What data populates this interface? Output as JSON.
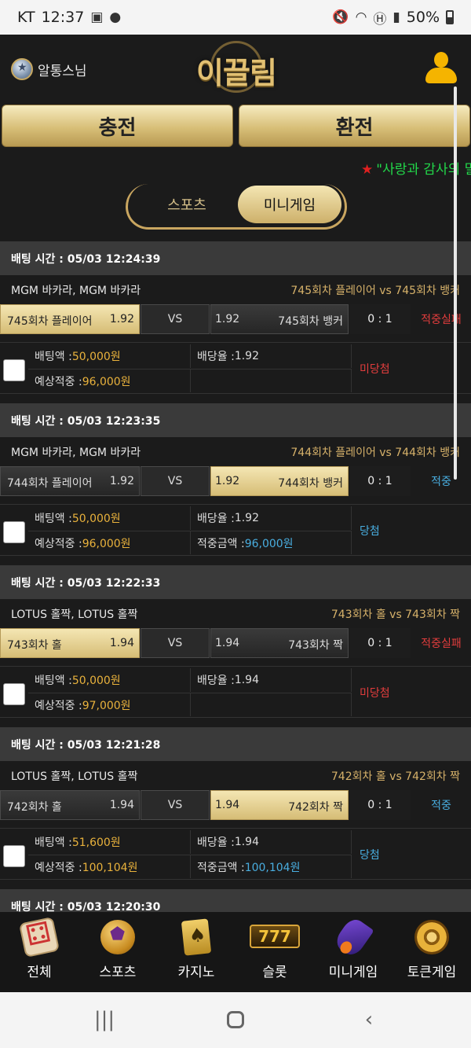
{
  "status_bar": {
    "carrier": "KT",
    "time": "12:37",
    "battery": "50%",
    "icons": [
      "gallery-icon",
      "chat-icon",
      "mute-icon",
      "wifi-icon",
      "hd-icon",
      "signal-icon",
      "battery-icon"
    ]
  },
  "header": {
    "user_name": "알통스님",
    "logo": "이끌림"
  },
  "actions": {
    "charge": "충전",
    "exchange": "환전"
  },
  "ticker": "\"사랑과 감사의 말",
  "tabs": [
    {
      "label": "스포츠",
      "active": false
    },
    {
      "label": "미니게임",
      "active": true
    }
  ],
  "labels": {
    "bet_amount": "배팅액 : ",
    "odds": "배당율 : ",
    "expected_win": "예상적중 : ",
    "win_amount": "적중금액 : ",
    "vs": "VS"
  },
  "bets": [
    {
      "time": "배팅 시간 : 05/03 12:24:39",
      "game": "MGM 바카라, MGM 바카라",
      "round": "745회차 플레이어  vs  745회차 뱅커",
      "left_name": "745회차 플레이어",
      "left_odds": "1.92",
      "right_odds": "1.92",
      "right_name": "745회차 뱅커",
      "selected": "left",
      "score": "0 : 1",
      "result": "적중실패",
      "amount": "50,000원",
      "odds": "1.92",
      "expected": "96,000원",
      "win_amount": "",
      "status": "미당첨"
    },
    {
      "time": "배팅 시간 : 05/03 12:23:35",
      "game": "MGM 바카라, MGM 바카라",
      "round": "744회차 플레이어  vs  744회차 뱅커",
      "left_name": "744회차 플레이어",
      "left_odds": "1.92",
      "right_odds": "1.92",
      "right_name": "744회차 뱅커",
      "selected": "right",
      "score": "0 : 1",
      "result": "적중",
      "amount": "50,000원",
      "odds": "1.92",
      "expected": "96,000원",
      "win_amount": "96,000원",
      "status": "당첨"
    },
    {
      "time": "배팅 시간 : 05/03 12:22:33",
      "game": "LOTUS 홀짝, LOTUS 홀짝",
      "round": "743회차 홀  vs  743회차 짝",
      "left_name": "743회차 홀",
      "left_odds": "1.94",
      "right_odds": "1.94",
      "right_name": "743회차 짝",
      "selected": "left",
      "score": "0 : 1",
      "result": "적중실패",
      "amount": "50,000원",
      "odds": "1.94",
      "expected": "97,000원",
      "win_amount": "",
      "status": "미당첨"
    },
    {
      "time": "배팅 시간 : 05/03 12:21:28",
      "game": "LOTUS 홀짝, LOTUS 홀짝",
      "round": "742회차 홀  vs  742회차 짝",
      "left_name": "742회차 홀",
      "left_odds": "1.94",
      "right_odds": "1.94",
      "right_name": "742회차 짝",
      "selected": "right",
      "score": "0 : 1",
      "result": "적중",
      "amount": "51,600원",
      "odds": "1.94",
      "expected": "100,104원",
      "win_amount": "100,104원",
      "status": "당첨"
    },
    {
      "time": "배팅 시간 : 05/03 12:20:30"
    }
  ],
  "bottom_nav": [
    {
      "label": "전체",
      "icon": "dice-icon"
    },
    {
      "label": "스포츠",
      "icon": "soccer-ball-icon"
    },
    {
      "label": "카지노",
      "icon": "cards-icon"
    },
    {
      "label": "슬롯",
      "icon": "slot-777-icon"
    },
    {
      "label": "미니게임",
      "icon": "rocket-icon"
    },
    {
      "label": "토큰게임",
      "icon": "roulette-icon"
    }
  ],
  "slot_text": "777",
  "colors": {
    "gold": "#d8bf78",
    "lose": "#e33d3d",
    "win": "#49aee0",
    "ticker": "#22d84a"
  }
}
